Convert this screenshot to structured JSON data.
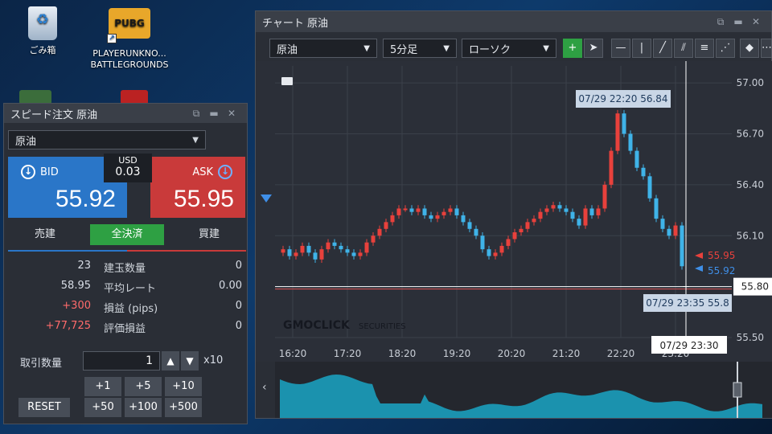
{
  "desktop": {
    "recycle_label": "ごみ箱",
    "pubg_logo": "PUBG",
    "pubg_label_1": "PLAYERUNKNO...",
    "pubg_label_2": "BATTLEGROUNDS"
  },
  "speed_order": {
    "title": "スピード注文 原油",
    "symbol": "原油",
    "bid_label": "BID",
    "bid_price": "55.92",
    "ask_label": "ASK",
    "ask_price": "55.95",
    "spread_unit": "USD",
    "spread_value": "0.03",
    "tabs": [
      "売建",
      "全決済",
      "買建"
    ],
    "stats": [
      {
        "left": "23",
        "label": "建玉数量",
        "right": "0"
      },
      {
        "left": "58.95",
        "label": "平均レート",
        "right": "0.00"
      },
      {
        "left": "+300",
        "label": "損益 (pips)",
        "right": "0"
      },
      {
        "left": "+77,725",
        "label": "評価損益",
        "right": "0"
      }
    ],
    "qty_label": "取引数量",
    "qty_value": "1",
    "qty_mult": "x10",
    "reset_label": "RESET",
    "increments_row1": [
      "+1",
      "+5",
      "+10"
    ],
    "increments_row2": [
      "+50",
      "+100",
      "+500"
    ]
  },
  "chart_window": {
    "title": "チャート 原油",
    "symbol": "原油",
    "interval": "5分足",
    "style": "ローソク",
    "watermark": "GMOCLICK",
    "watermark_suffix": "SECURITIES",
    "tooltip_high": "07/29 22:20 56.84",
    "tooltip_cursor": "07/29 23:35 55.8",
    "time_cursor": "07/29 23:30",
    "bid_tag": "55.92",
    "ask_tag": "55.95",
    "cursor_price": "55.80"
  },
  "chart_data": {
    "type": "candlestick",
    "ylim": [
      55.5,
      57.1
    ],
    "y_ticks": [
      "57.00",
      "56.70",
      "56.40",
      "56.10",
      "55.80",
      "55.50"
    ],
    "x_ticks": [
      "16:20",
      "17:20",
      "18:20",
      "19:20",
      "20:20",
      "21:20",
      "22:20",
      "23:20"
    ],
    "close_series": [
      56.0,
      56.02,
      55.98,
      56.0,
      56.04,
      56.0,
      55.96,
      56.02,
      56.06,
      56.04,
      56.02,
      56.0,
      55.98,
      56.0,
      56.06,
      56.1,
      56.14,
      56.18,
      56.22,
      56.26,
      56.26,
      56.24,
      56.26,
      56.22,
      56.2,
      56.22,
      56.24,
      56.26,
      56.22,
      56.18,
      56.14,
      56.1,
      56.02,
      55.98,
      56.0,
      56.04,
      56.08,
      56.12,
      56.14,
      56.18,
      56.2,
      56.24,
      56.26,
      56.28,
      56.26,
      56.24,
      56.2,
      56.16,
      56.26,
      56.22,
      56.26,
      56.4,
      56.6,
      56.82,
      56.7,
      56.6,
      56.5,
      56.45,
      56.32,
      56.2,
      56.14,
      56.1,
      56.16,
      55.92
    ]
  },
  "colors": {
    "up": "#e8413c",
    "down": "#3fb3e8",
    "bid": "#2a76c8",
    "ask": "#c93a3a",
    "green": "#2ea043"
  }
}
